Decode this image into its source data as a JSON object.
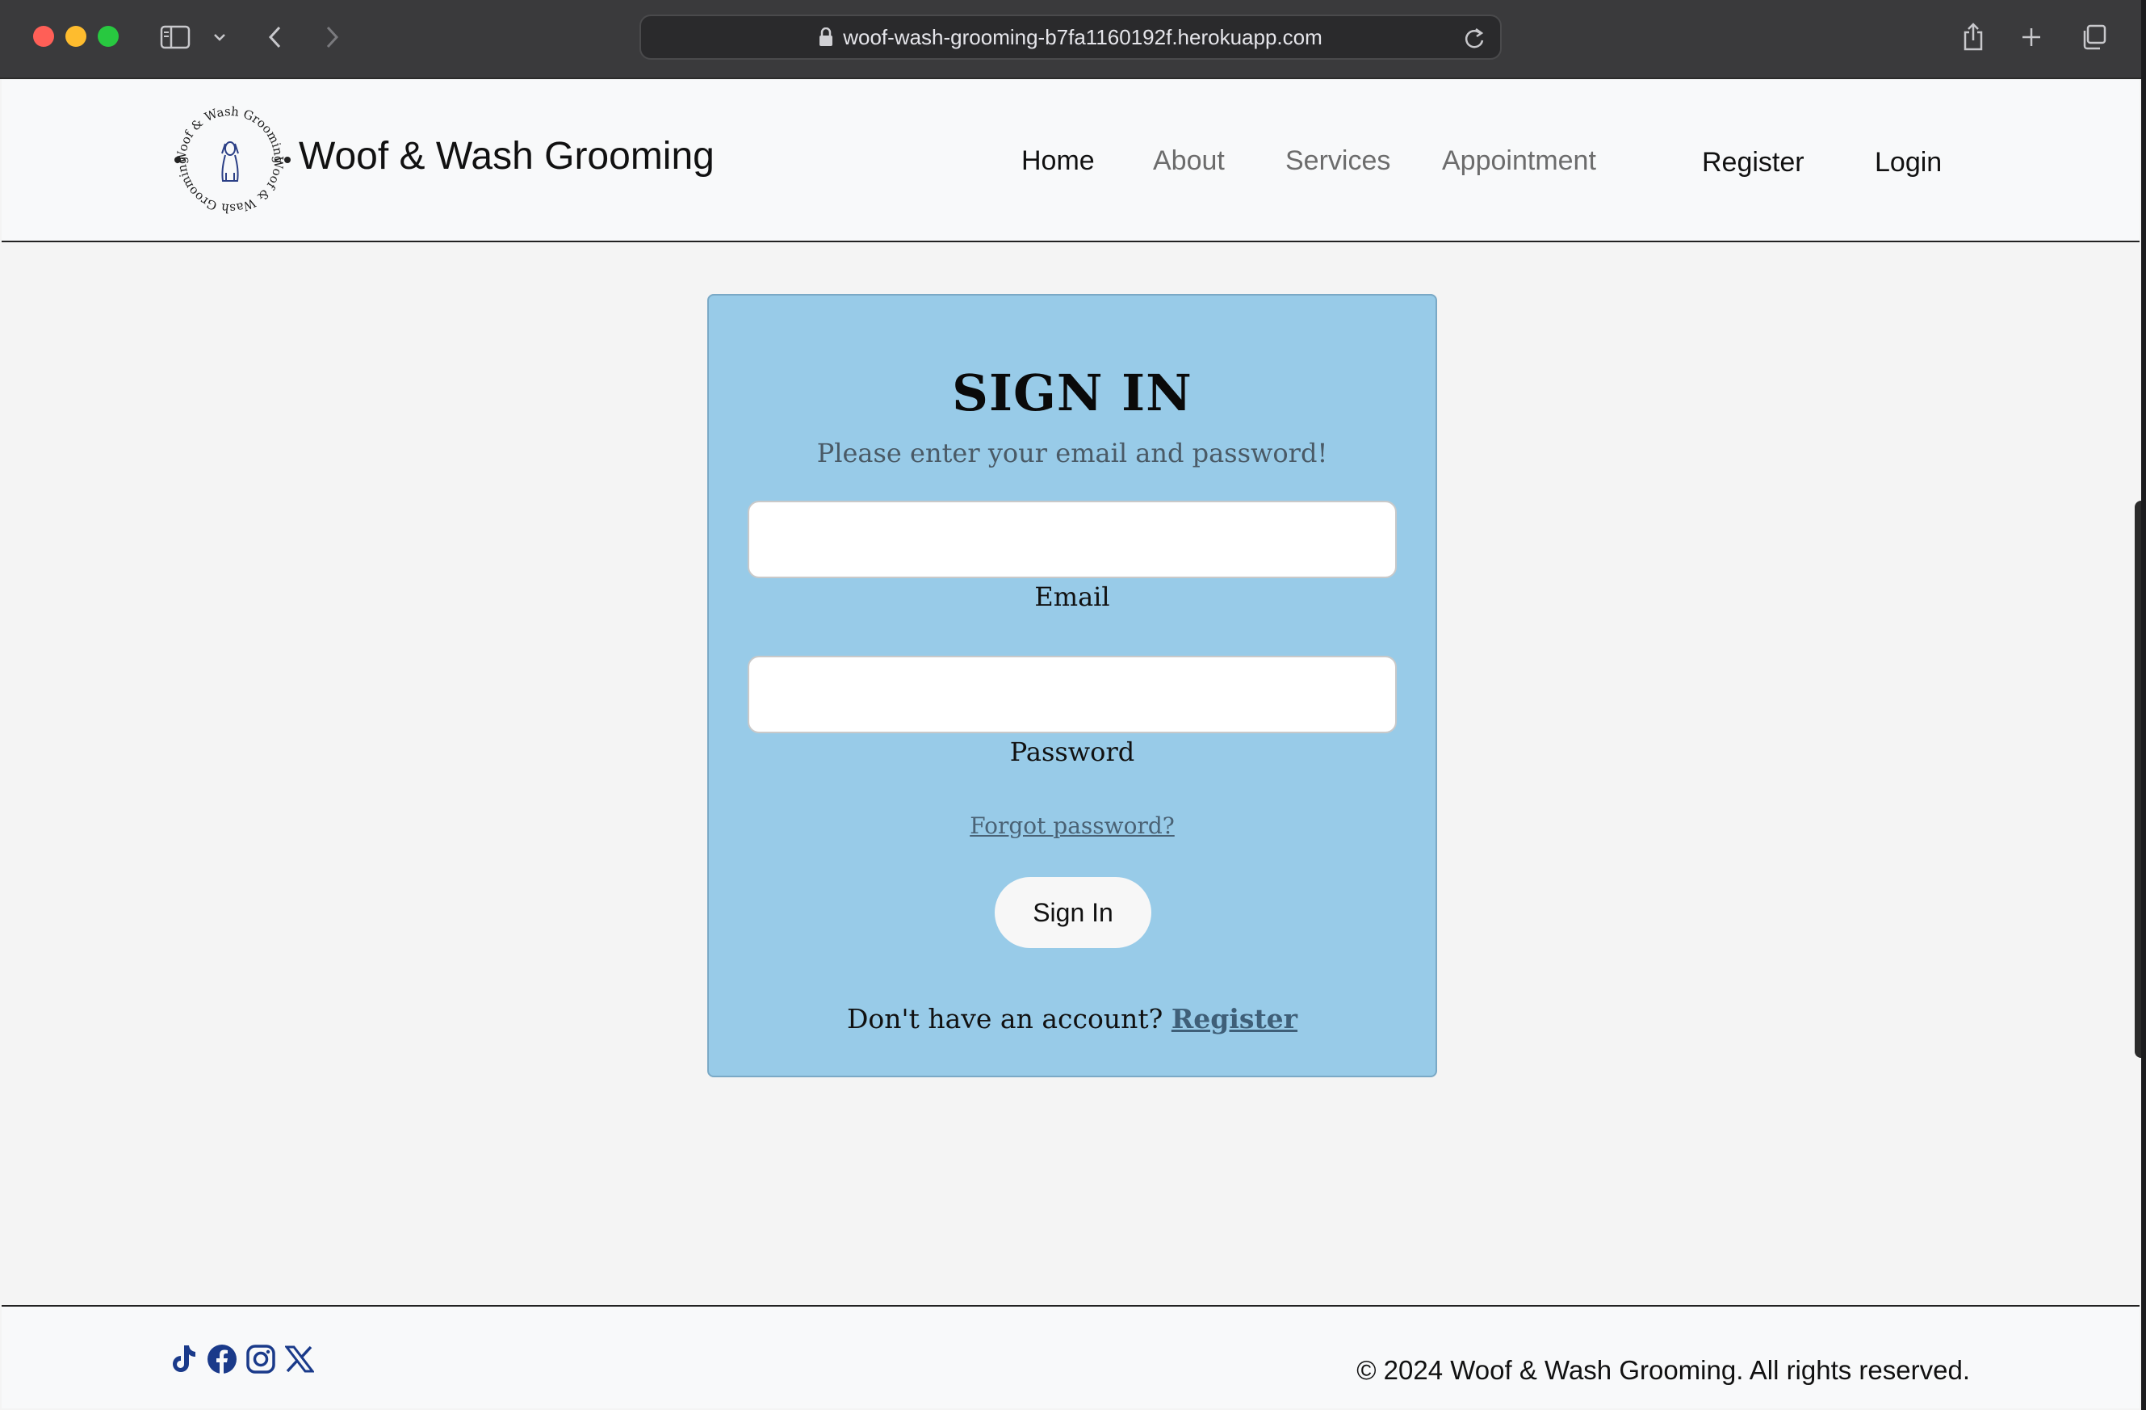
{
  "browser": {
    "url": "woof-wash-grooming-b7fa1160192f.herokuapp.com",
    "icons": [
      "sidebar-icon",
      "chevron-down-icon",
      "back-icon",
      "forward-icon",
      "lock-icon",
      "reload-icon",
      "share-icon",
      "new-tab-icon",
      "tabs-overview-icon"
    ]
  },
  "navbar": {
    "brand": "Woof & Wash Grooming",
    "logo_text": "Woof & Wash Grooming",
    "links": {
      "home": "Home",
      "about": "About",
      "services": "Services",
      "appointment": "Appointment",
      "register": "Register",
      "login": "Login"
    },
    "active": "Home"
  },
  "signin": {
    "title": "SIGN IN",
    "subtitle": "Please enter your email and password!",
    "email_label": "Email",
    "email_value": "",
    "password_label": "Password",
    "password_value": "",
    "forgot": "Forgot password?",
    "button": "Sign In",
    "no_account": "Don't have an account?",
    "register_link": "Register"
  },
  "footer": {
    "social_icons": [
      "tiktok-icon",
      "facebook-icon",
      "instagram-icon",
      "x-icon"
    ],
    "copyright": "© 2024 Woof & Wash Grooming. All rights reserved."
  },
  "colors": {
    "card_background": "#98cbe8",
    "social_icon": "#1a3a8a"
  }
}
